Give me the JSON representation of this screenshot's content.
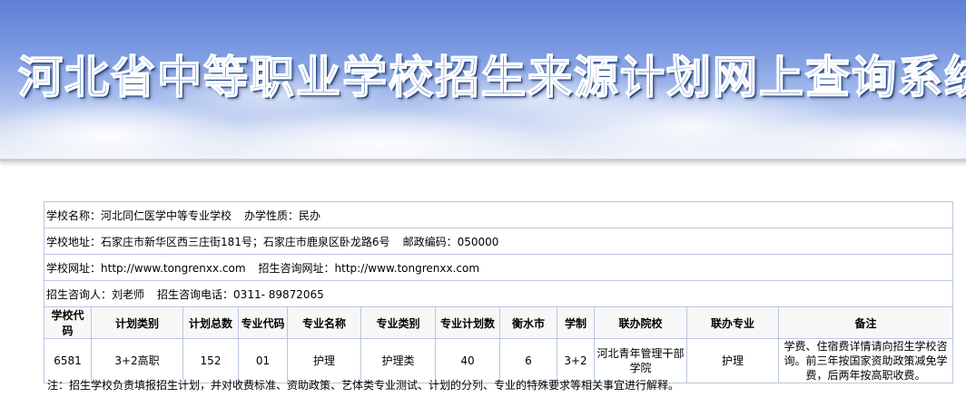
{
  "banner": {
    "title": "河北省中等职业学校招生来源计划网上查询系统"
  },
  "school": {
    "name_label": "学校名称：",
    "name": "河北同仁医学中等专业学校",
    "type_label": "办学性质：",
    "type": "民办",
    "address_label": "学校地址：",
    "address": "石家庄市新华区西三庄街181号；石家庄市鹿泉区卧龙路6号",
    "postcode_label": "邮政编码：",
    "postcode": "050000",
    "website_label": "学校网址：",
    "website": "http://www.tongrenxx.com",
    "consult_site_label": "招生咨询网址：",
    "consult_site": "http://www.tongrenxx.com",
    "contact_label": "招生咨询人：",
    "contact": "刘老师",
    "phone_label": "招生咨询电话：",
    "phone": "0311- 89872065"
  },
  "table": {
    "headers": [
      "学校代码",
      "计划类别",
      "计划总数",
      "专业代码",
      "专业名称",
      "专业类别",
      "专业计划数",
      "衡水市",
      "学制",
      "联办院校",
      "联办专业",
      "备注"
    ],
    "rows": [
      [
        "6581",
        "3+2高职",
        "152",
        "01",
        "护理",
        "护理类",
        "40",
        "6",
        "3+2",
        "河北青年管理干部学院",
        "护理",
        "学费、住宿费详情请向招生学校咨询。前三年按国家资助政策减免学费，后两年按高职收费。"
      ]
    ]
  },
  "footnote": "注：招生学校负责填报招生计划，并对收费标准、资助政策、艺体类专业测试、计划的分列、专业的特殊要求等相关事宜进行解释。"
}
